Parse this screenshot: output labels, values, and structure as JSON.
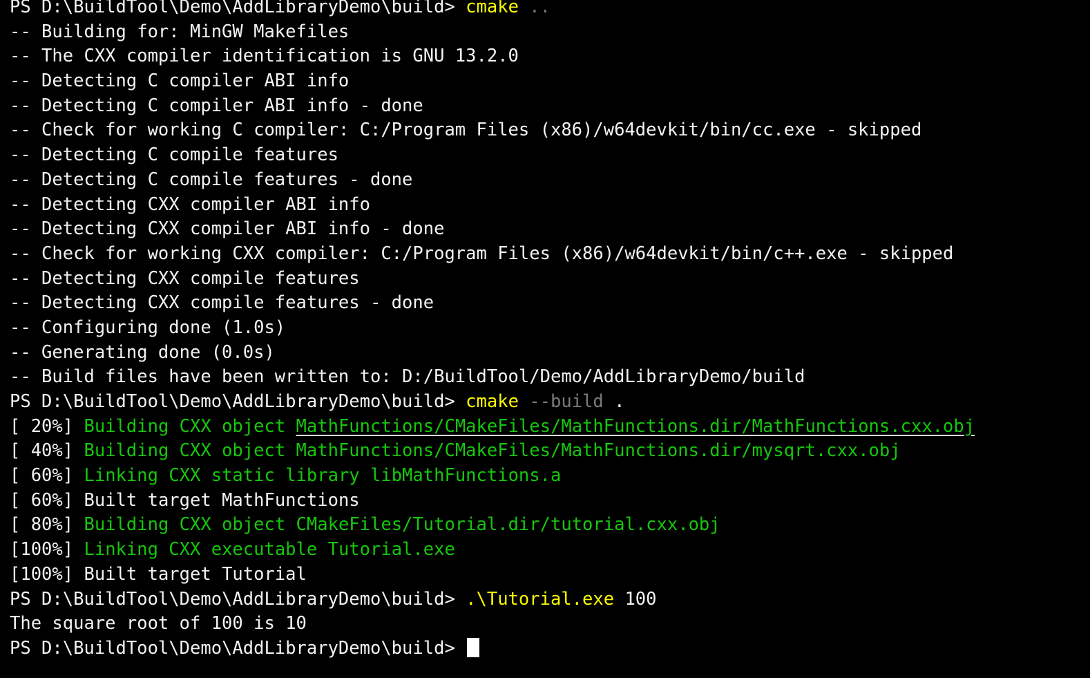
{
  "terminal": {
    "shell": "PowerShell",
    "background_color": "#000000",
    "foreground_color": "#f2f2f2",
    "accent_colors": {
      "command_yellow": "#f9f902",
      "build_green": "#16c60c",
      "dim_gray": "#7a7a7a",
      "link_underline": "#d8d8d8"
    },
    "prompt": "PS D:\\BuildTool\\Demo\\AddLibraryDemo\\build>",
    "cursor": "block"
  },
  "lines": [
    {
      "type": "prompt",
      "prompt": "PS D:\\BuildTool\\Demo\\AddLibraryDemo\\build>",
      "command": "cmake",
      "args": ".."
    },
    {
      "type": "status",
      "text": "-- Building for: MinGW Makefiles"
    },
    {
      "type": "status",
      "text": "-- The CXX compiler identification is GNU 13.2.0"
    },
    {
      "type": "status",
      "text": "-- Detecting C compiler ABI info"
    },
    {
      "type": "status",
      "text": "-- Detecting C compiler ABI info - done"
    },
    {
      "type": "status",
      "text": "-- Check for working C compiler: C:/Program Files (x86)/w64devkit/bin/cc.exe - skipped"
    },
    {
      "type": "status",
      "text": "-- Detecting C compile features"
    },
    {
      "type": "status",
      "text": "-- Detecting C compile features - done"
    },
    {
      "type": "status",
      "text": "-- Detecting CXX compiler ABI info"
    },
    {
      "type": "status",
      "text": "-- Detecting CXX compiler ABI info - done"
    },
    {
      "type": "status",
      "text": "-- Check for working CXX compiler: C:/Program Files (x86)/w64devkit/bin/c++.exe - skipped"
    },
    {
      "type": "status",
      "text": "-- Detecting CXX compile features"
    },
    {
      "type": "status",
      "text": "-- Detecting CXX compile features - done"
    },
    {
      "type": "status",
      "text": "-- Configuring done (1.0s)"
    },
    {
      "type": "status",
      "text": "-- Generating done (0.0s)"
    },
    {
      "type": "status",
      "text": "-- Build files have been written to: D:/BuildTool/Demo/AddLibraryDemo/build"
    },
    {
      "type": "prompt",
      "prompt": "PS D:\\BuildTool\\Demo\\AddLibraryDemo\\build>",
      "command": "cmake",
      "flag": "--build",
      "args": "."
    },
    {
      "type": "build",
      "percent": "[ 20%]",
      "message": "Building CXX object ",
      "path": "MathFunctions/CMakeFiles/MathFunctions.dir/MathFunctions.cxx.obj",
      "linked": true
    },
    {
      "type": "build",
      "percent": "[ 40%]",
      "message": "Building CXX object MathFunctions/CMakeFiles/MathFunctions.dir/mysqrt.cxx.obj",
      "linked": false
    },
    {
      "type": "build",
      "percent": "[ 60%]",
      "message": "Linking CXX static library libMathFunctions.a",
      "linked": false
    },
    {
      "type": "built",
      "percent": "[ 60%]",
      "message": "Built target MathFunctions"
    },
    {
      "type": "build",
      "percent": "[ 80%]",
      "message": "Building CXX object CMakeFiles/Tutorial.dir/tutorial.cxx.obj",
      "linked": false
    },
    {
      "type": "build",
      "percent": "[100%]",
      "message": "Linking CXX executable Tutorial.exe",
      "linked": false
    },
    {
      "type": "built",
      "percent": "[100%]",
      "message": "Built target Tutorial"
    },
    {
      "type": "prompt",
      "prompt": "PS D:\\BuildTool\\Demo\\AddLibraryDemo\\build>",
      "command": ".\\Tutorial.exe",
      "args": "100"
    },
    {
      "type": "status",
      "text": "The square root of 100 is 10"
    },
    {
      "type": "prompt",
      "prompt": "PS D:\\BuildTool\\Demo\\AddLibraryDemo\\build>",
      "command": "",
      "cursor": true
    }
  ]
}
